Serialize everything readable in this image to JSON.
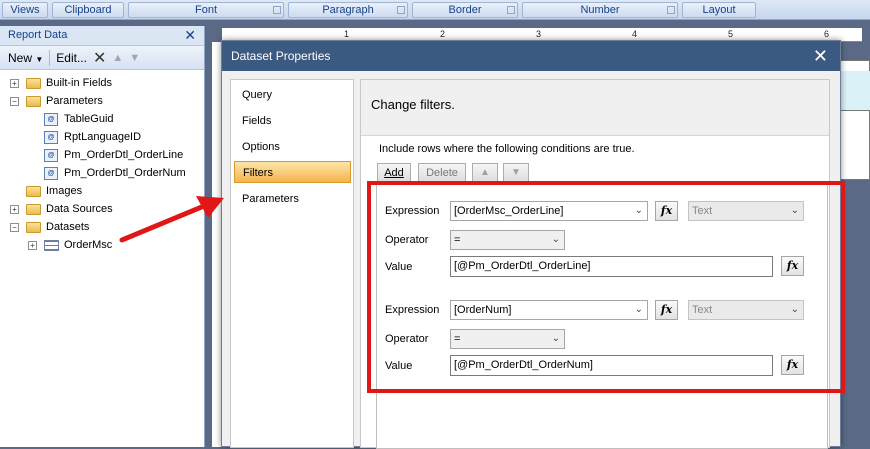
{
  "ribbon": {
    "groups": [
      "Views",
      "Clipboard",
      "Font",
      "Paragraph",
      "Border",
      "Number",
      "Layout"
    ]
  },
  "report_data": {
    "title": "Report Data",
    "toolbar": {
      "new_label": "New",
      "edit_label": "Edit..."
    },
    "tree": [
      {
        "label": "Built-in Fields",
        "type": "folder",
        "expanded": false
      },
      {
        "label": "Parameters",
        "type": "folder",
        "expanded": true
      },
      {
        "label": "TableGuid",
        "type": "parameter"
      },
      {
        "label": "RptLanguageID",
        "type": "parameter"
      },
      {
        "label": "Pm_OrderDtl_OrderLine",
        "type": "parameter"
      },
      {
        "label": "Pm_OrderDtl_OrderNum",
        "type": "parameter"
      },
      {
        "label": "Images",
        "type": "folder"
      },
      {
        "label": "Data Sources",
        "type": "folder",
        "expanded": false
      },
      {
        "label": "Datasets",
        "type": "folder",
        "expanded": true
      },
      {
        "label": "OrderMsc",
        "type": "dataset",
        "expanded": false
      }
    ]
  },
  "ruler": {
    "marks": [
      "1",
      "2",
      "3",
      "4",
      "5",
      "6"
    ]
  },
  "dialog": {
    "title": "Dataset Properties",
    "nav": [
      "Query",
      "Fields",
      "Options",
      "Filters",
      "Parameters"
    ],
    "active_nav": "Filters",
    "header": "Change filters.",
    "instruction": "Include rows where the following conditions are true.",
    "buttons": {
      "add": "Add",
      "delete": "Delete"
    },
    "filters": [
      {
        "expression_label": "Expression",
        "expression": "[OrderMsc_OrderLine]",
        "type": "Text",
        "operator_label": "Operator",
        "operator": "=",
        "value_label": "Value",
        "value": "[@Pm_OrderDtl_OrderLine]"
      },
      {
        "expression_label": "Expression",
        "expression": "[OrderNum]",
        "type": "Text",
        "operator_label": "Operator",
        "operator": "=",
        "value_label": "Value",
        "value": "[@Pm_OrderDtl_OrderNum]"
      }
    ]
  },
  "colors": {
    "highlight": "#e11616",
    "title_bar": "#3b5a82",
    "active_nav": "#f6b34e"
  }
}
